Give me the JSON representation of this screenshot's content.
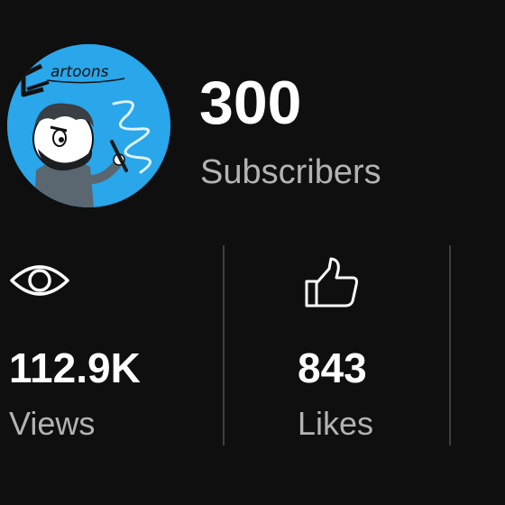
{
  "channel": {
    "avatar_logo_text": "Cartoons",
    "subscribers_value": "300",
    "subscribers_label": "Subscribers"
  },
  "stats": [
    {
      "icon": "eye-icon",
      "value": "112.9K",
      "label": "Views"
    },
    {
      "icon": "thumbs-up-icon",
      "value": "843",
      "label": "Likes"
    }
  ],
  "colors": {
    "background": "#0f0f0f",
    "primary_text": "#ffffff",
    "secondary_text": "#b3b3b3",
    "divider": "#3f3f3f",
    "avatar_bg": "#2aa6ea"
  }
}
